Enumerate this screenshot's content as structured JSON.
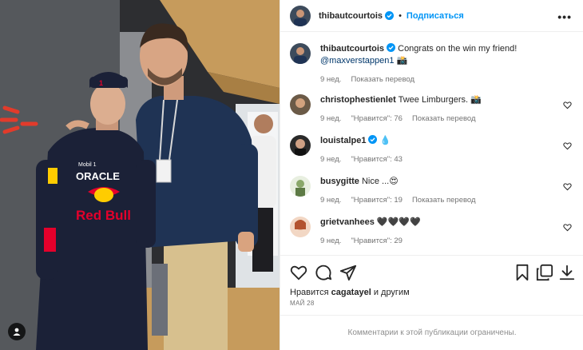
{
  "header": {
    "username": "thibautcourtois",
    "follow_label": "Подписаться",
    "separator": "•",
    "more_label": "•••"
  },
  "caption": {
    "username": "thibautcourtois",
    "text": " Congrats on the win my friend!",
    "mention": "@maxverstappen1",
    "time": "9 нед.",
    "translate": "Показать перевод"
  },
  "comments": [
    {
      "username": "christophestienlet",
      "text": " Twee Limburgers. 📸",
      "time": "9 нед.",
      "likes": "\"Нравится\": 76",
      "translate": "Показать перевод",
      "verified": false
    },
    {
      "username": "louistalpe1",
      "text": " 💧",
      "time": "9 нед.",
      "likes": "\"Нравится\": 43",
      "translate": "",
      "verified": true
    },
    {
      "username": "busygitte",
      "text": " Nice ...😍",
      "time": "9 нед.",
      "likes": "\"Нравится\": 19",
      "translate": "Показать перевод",
      "verified": false
    },
    {
      "username": "grietvanhees",
      "text": " 🖤🖤🖤🖤",
      "time": "9 нед.",
      "likes": "\"Нравится\": 29",
      "translate": "",
      "verified": false
    }
  ],
  "likes": {
    "prefix": "Нравится ",
    "user": "cagatayel",
    "suffix": " и другим"
  },
  "date": "МАЙ 28",
  "limited_notice": "Комментарии к этой публикации ограничены.",
  "photo": {
    "suit_brand_1": "ORACLE",
    "suit_brand_2": "Red Bull",
    "suit_sponsor": "Mobil 1"
  },
  "colors": {
    "accent": "#0095f6",
    "text": "#262626",
    "secondary": "#737373",
    "verified": "#0095f6"
  },
  "icons": [
    "more-icon",
    "heart-icon",
    "comment-icon",
    "share-icon",
    "bookmark-icon",
    "copy-icon",
    "download-icon",
    "verified-icon",
    "tag-user-icon"
  ]
}
